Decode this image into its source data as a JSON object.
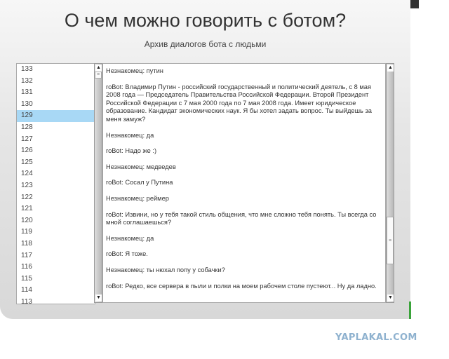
{
  "header": {
    "title": "О чем можно говорить с ботом?",
    "subtitle": "Архив диалогов бота с людьми"
  },
  "dialog_list": {
    "items": [
      "133",
      "132",
      "131",
      "130",
      "129",
      "128",
      "127",
      "126",
      "125",
      "124",
      "123",
      "122",
      "121",
      "120",
      "119",
      "118",
      "117",
      "116",
      "115",
      "114",
      "113"
    ],
    "selected": "129"
  },
  "chat": {
    "messages": [
      "Незнакомец: путин",
      "roBot: Владимир Путин - российский государственный и политический деятель, с 8 мая 2008 года — Председатель Правительства Российской Федерации. Второй Президент Российской Федерации с 7 мая 2000 года по 7 мая 2008 года. Имеет юридическое образование. Кандидат экономических наук. Я бы хотел задать вопрос. Ты выйдешь за меня замуж?",
      "Незнакомец: да",
      "roBot: Надо же :)",
      "Незнакомец: медведев",
      "roBot: Сосал у Путина",
      "Незнакомец: реймер",
      "roBot: Извини, но у тебя такой стиль общения, что мне сложно тебя понять. Ты всегда со мной соглашаешься?",
      "Незнакомец: да",
      "roBot: Я тоже.",
      "Незнакомец: ты нюхал попу у собачки?",
      "roBot: Редко, все сервера в пыли и полки на моем рабочем столе пустеют... Ну да ладно."
    ]
  },
  "watermark": "YAPLAKAL.COM",
  "colors": {
    "selected": "#a8d8f5",
    "accent": "#3aa33a",
    "watermark": "#8fb2cf"
  }
}
